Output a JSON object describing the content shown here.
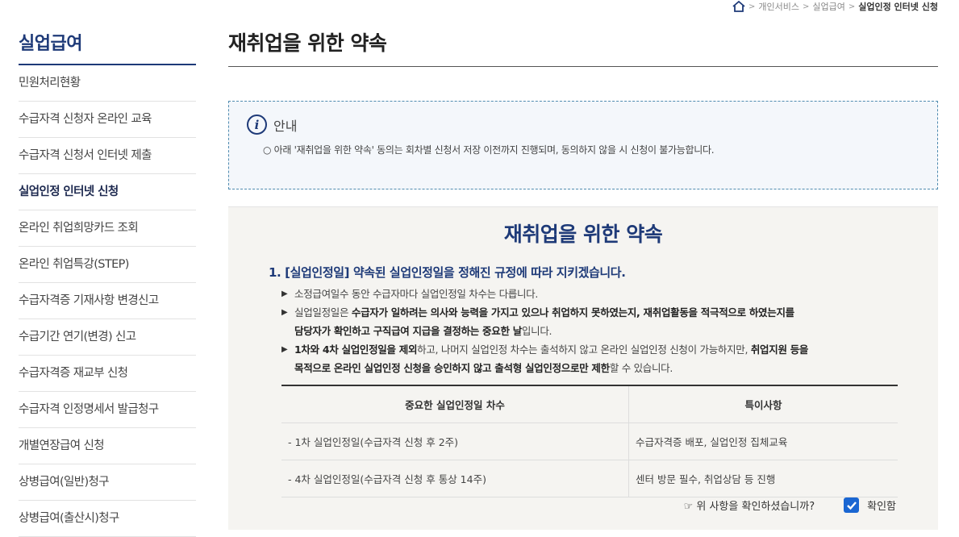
{
  "breadcrumb": {
    "items": [
      "개인서비스",
      "실업급여",
      "실업인정 인터넷 신청"
    ]
  },
  "sidebar": {
    "title": "실업급여",
    "items": [
      {
        "label": "민원처리현황"
      },
      {
        "label": "수급자격 신청자 온라인 교육"
      },
      {
        "label": "수급자격 신청서 인터넷 제출"
      },
      {
        "label": "실업인정 인터넷 신청",
        "active": true
      },
      {
        "label": "온라인 취업희망카드 조회"
      },
      {
        "label": "온라인 취업특강(STEP)"
      },
      {
        "label": "수급자격증 기재사항 변경신고"
      },
      {
        "label": "수급기간 연기(변경) 신고"
      },
      {
        "label": "수급자격증 재교부 신청"
      },
      {
        "label": "수급자격 인정명세서 발급청구"
      },
      {
        "label": "개별연장급여 신청"
      },
      {
        "label": "상병급여(일반)청구"
      },
      {
        "label": "상병급여(출산시)청구"
      }
    ]
  },
  "page": {
    "title": "재취업을 위한 약속"
  },
  "notice": {
    "icon": "info-icon",
    "title": "안내",
    "text": "○ 아래 '재취업을 위한 약속' 동의는 회차별 신청서 저장 이전까지 진행되며, 동의하지 않을 시 신청이 불가능합니다."
  },
  "promise": {
    "title": "재취업을 위한 약속",
    "heading": "1. [실업인정일] 약속된 실업인정일을 정해진 규정에 따라 지키겠습니다.",
    "bullet1": "소정급여일수 동안 수급자마다 실업인정일 차수는 다릅니다.",
    "bullet2": {
      "a": "실업일정일은 ",
      "b": "수급자가 일하려는 의사와 능력을 가지고 있으나 취업하지 못하였는지, 재취업활동을 적극적으로 하였는지를",
      "c": "담당자가 확인하고 구직급여 지급을 결정하는 중요한 날",
      "d": "입니다."
    },
    "bullet3": {
      "a": "1차와 4차 실업인정일을 제외",
      "b": "하고, 나머지 실업인정 차수는 출석하지 않고 온라인 실업인정 신청이 가능하지만, ",
      "c": "취업지원 등을",
      "d": "목적으로 온라인 실업인정 신청을 승인하지 않고 출석형 실업인정으로만 제한",
      "e": "할 수 있습니다."
    },
    "table": {
      "headers": [
        "중요한 실업인정일 차수",
        "특이사항"
      ],
      "rows": [
        [
          "- 1차 실업인정일(수급자격 신청 후 2주)",
          "수급자격증 배포, 실업인정 집체교육"
        ],
        [
          "- 4차 실업인정일(수급자격 신청 후 통상 14주)",
          "센터 방문 필수, 취업상담 등 진행"
        ]
      ]
    },
    "confirm_question": "☞ 위 사항을 확인하셨습니까?",
    "confirm_label": "확인함",
    "confirm_checked": true
  },
  "colors": {
    "brand": "#1e3a78",
    "checkbox": "#1a66d2"
  }
}
